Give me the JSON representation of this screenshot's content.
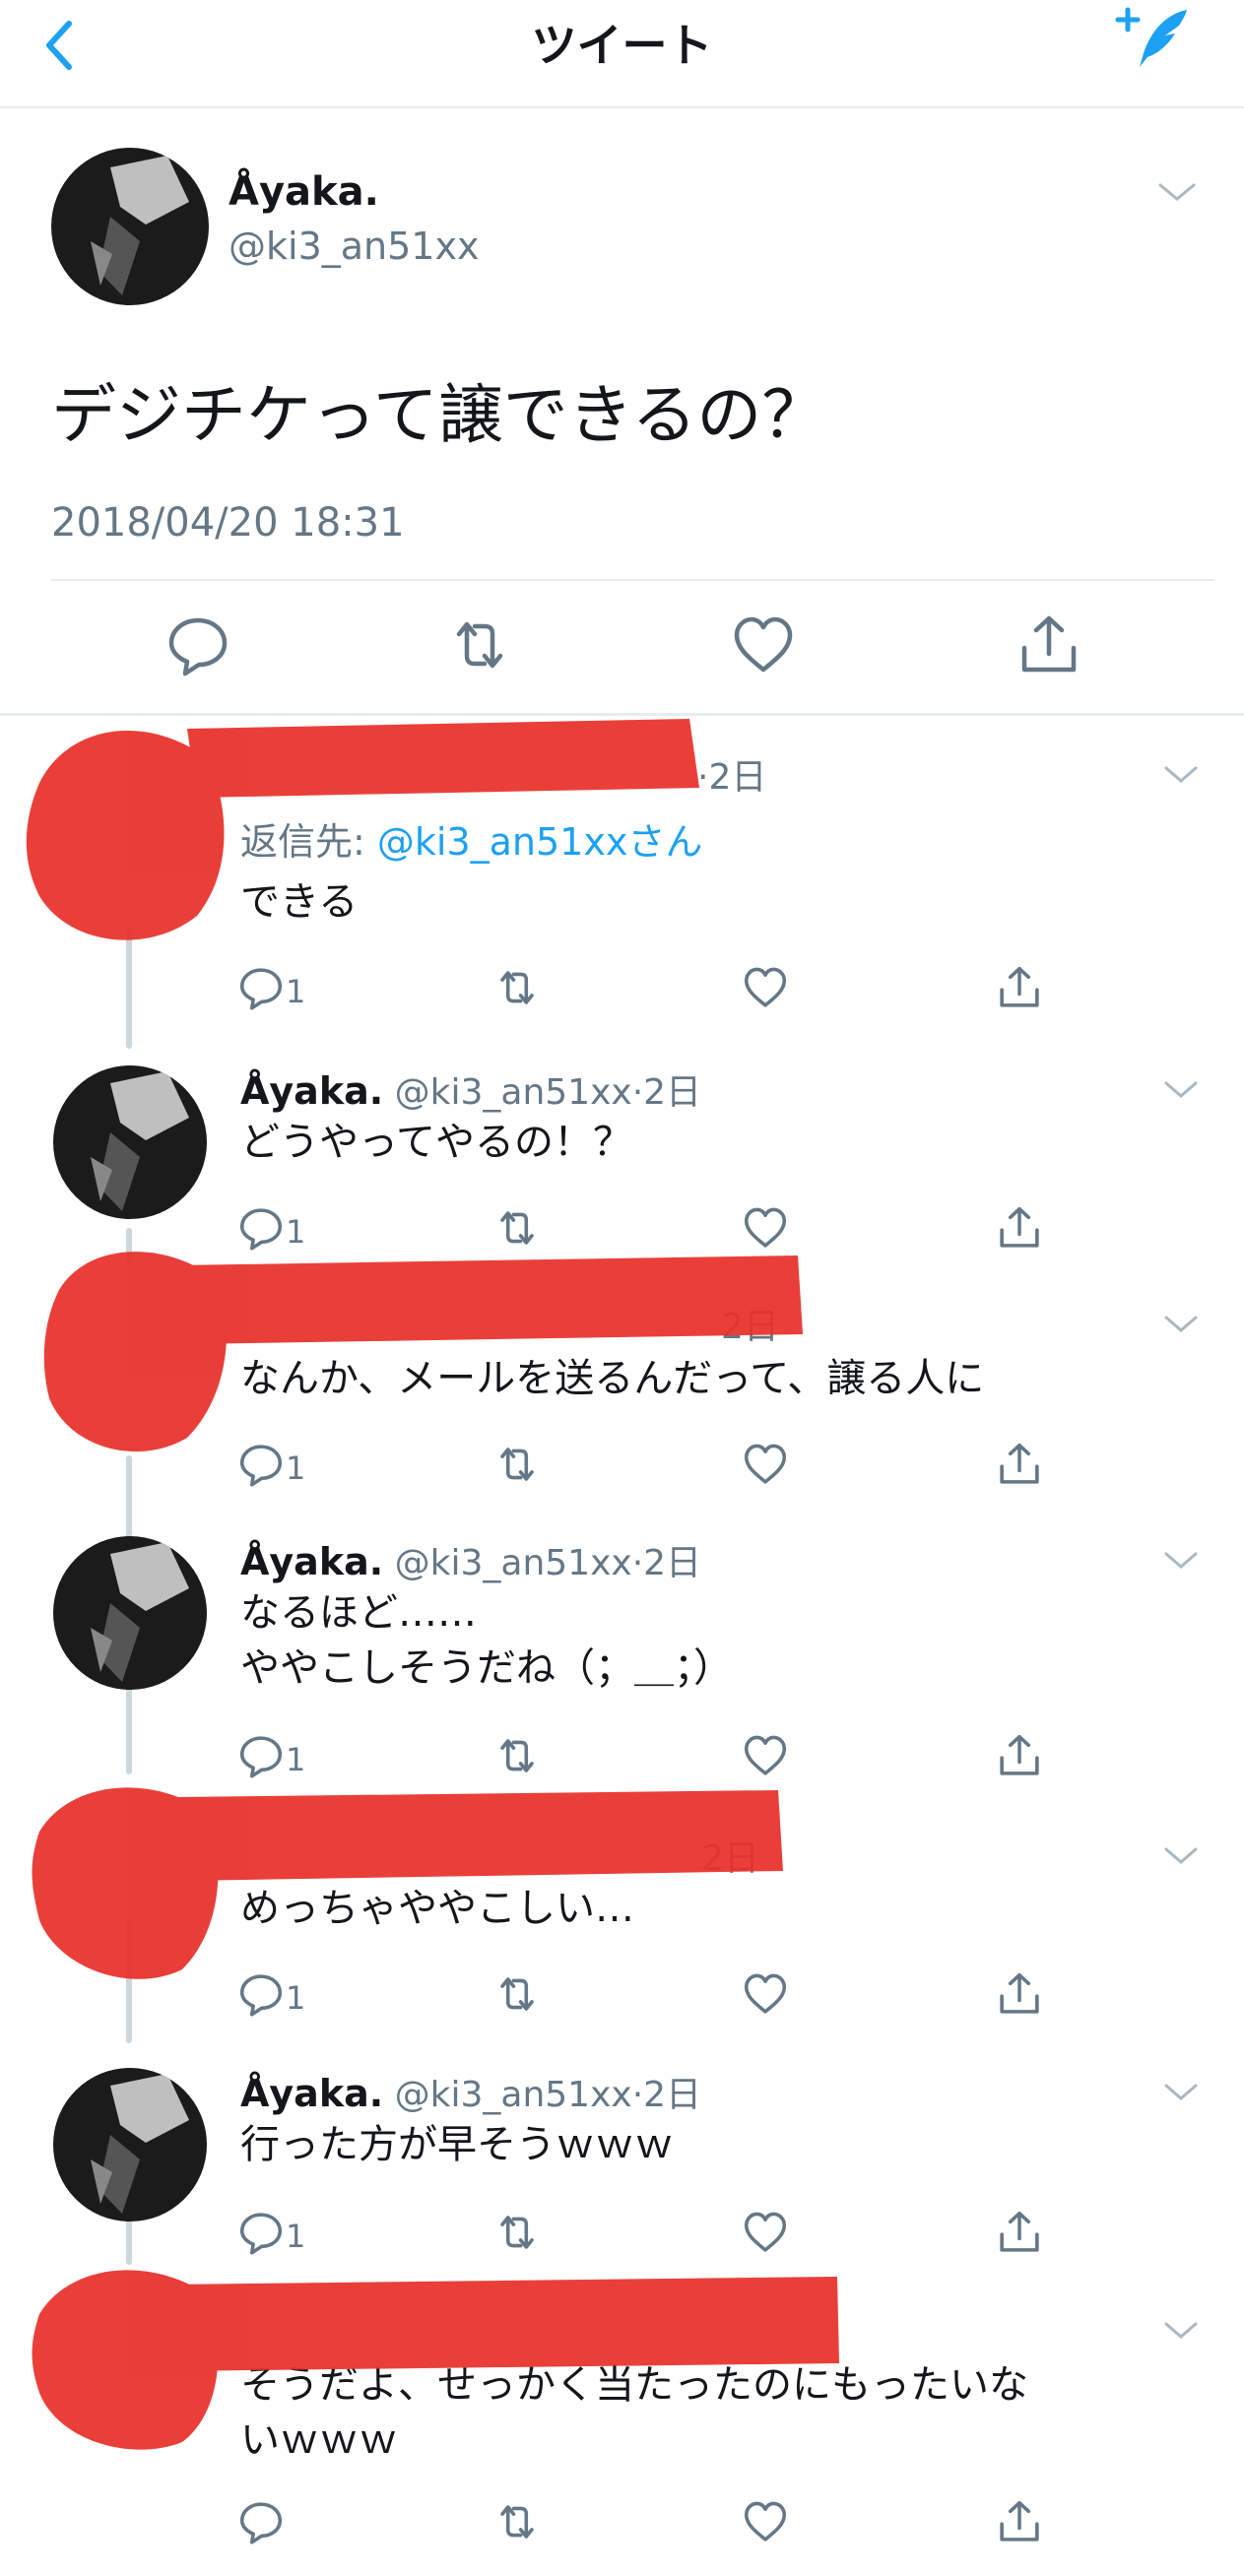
{
  "header": {
    "title": "ツイート"
  },
  "main_tweet": {
    "name": "Åyaka.",
    "handle": "@ki3_an51xx",
    "text": "デジチケって譲できるの？",
    "timestamp": "2018/04/20 18:31"
  },
  "replies": [
    {
      "name": "",
      "handle": "",
      "time": "·2日",
      "reply_prefix": "返信先: ",
      "reply_to": "@ki3_an51xxさん",
      "text": "できる",
      "reply_count": "1",
      "redacted": true
    },
    {
      "name": "Åyaka.",
      "handle": "@ki3_an51xx",
      "time": "·2日",
      "text": "どうやってやるの！？",
      "reply_count": "1",
      "redacted": false
    },
    {
      "name": "",
      "handle": "",
      "time": "2日",
      "text": "なんか、メールを送るんだって、譲る人に",
      "reply_count": "1",
      "redacted": true
    },
    {
      "name": "Åyaka.",
      "handle": "@ki3_an51xx",
      "time": "·2日",
      "text": "なるほど……\nややこしそうだね（；＿；）",
      "reply_count": "1",
      "redacted": false
    },
    {
      "name": "",
      "handle": "",
      "time": "2日",
      "text": "めっちゃややこしい…",
      "reply_count": "1",
      "redacted": true
    },
    {
      "name": "Åyaka.",
      "handle": "@ki3_an51xx",
      "time": "·2日",
      "text": "行った方が早そうｗｗｗ",
      "reply_count": "1",
      "redacted": false
    },
    {
      "name": "",
      "handle": "",
      "time": "",
      "text": "そうだよ、せっかく当たったのにもったいな\nいｗｗｗ",
      "reply_count": "",
      "redacted": true
    }
  ],
  "colors": {
    "accent": "#1da1f2",
    "text": "#14171a",
    "secondary": "#657786",
    "redaction": "#e8302a",
    "divider": "#e6ecf0"
  },
  "icons": [
    "back-chevron-icon",
    "compose-tweet-icon",
    "reply-icon",
    "retweet-icon",
    "like-icon",
    "share-icon",
    "caret-down-icon"
  ]
}
